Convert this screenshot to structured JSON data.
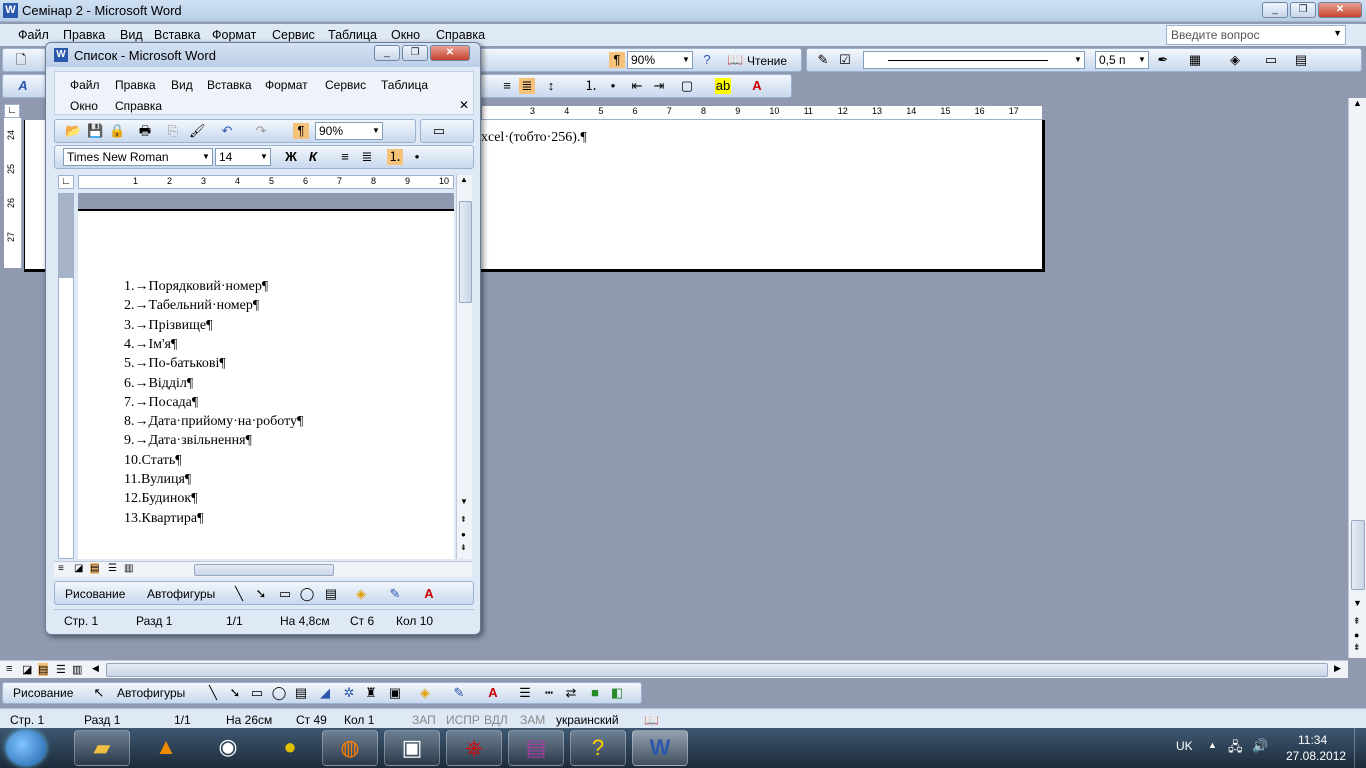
{
  "main_window": {
    "title": "Семінар 2 - Microsoft Word",
    "menu": [
      "Файл",
      "Правка",
      "Вид",
      "Вставка",
      "Формат",
      "Сервис",
      "Таблица",
      "Окно",
      "Справка"
    ],
    "help_placeholder": "Введите вопрос",
    "zoom": "90%",
    "reading_label": "Чтение",
    "line_weight": "0,5 п",
    "doc_text": "xcel·(тобто·256).¶",
    "ruler_ticks": [
      "3",
      "4",
      "5",
      "6",
      "7",
      "8",
      "9",
      "10",
      "11",
      "12",
      "13",
      "14",
      "15",
      "16",
      "17"
    ],
    "vruler_ticks": [
      "24",
      "25",
      "26",
      "27"
    ],
    "drawing_label": "Рисование",
    "autoshapes_label": "Автофигуры",
    "status": {
      "page": "Стр. 1",
      "section": "Разд 1",
      "pages": "1/1",
      "at": "На 26см",
      "line": "Ст 49",
      "col": "Кол 1",
      "rec": "ЗАП",
      "trk": "ИСПР",
      "ext": "ВДЛ",
      "ovr": "ЗАМ",
      "lang": "украинский"
    }
  },
  "inner_window": {
    "title": "Список - Microsoft Word",
    "menu_row1": [
      "Файл",
      "Правка",
      "Вид",
      "Вставка",
      "Формат",
      "Сервис",
      "Таблица"
    ],
    "menu_row2": [
      "Окно",
      "Справка"
    ],
    "zoom": "90%",
    "font": "Times New Roman",
    "size": "14",
    "bold": "Ж",
    "italic": "К",
    "ruler_ticks": [
      "1",
      "2",
      "3",
      "4",
      "5",
      "6",
      "7",
      "8",
      "9",
      "10"
    ],
    "list": [
      "1.→Порядковий·номер¶",
      "2.→Табельний·номер¶",
      "3.→Прізвище¶",
      "4.→Ім'я¶",
      "5.→По-батькові¶",
      "6.→Відділ¶",
      "7.→Посада¶",
      "8.→Дата·прийому·на·роботу¶",
      "9.→Дата·звільнення¶",
      "10.Стать¶",
      "11.Вулиця¶",
      "12.Будинок¶",
      "13.Квартира¶"
    ],
    "drawing_label": "Рисование",
    "autoshapes_label": "Автофигуры",
    "status": {
      "page": "Стр. 1",
      "section": "Разд 1",
      "pages": "1/1",
      "at": "На 4,8см",
      "line": "Ст 6",
      "col": "Кол 10"
    }
  },
  "taskbar": {
    "lang": "UK",
    "time": "11:34",
    "date": "27.08.2012"
  }
}
